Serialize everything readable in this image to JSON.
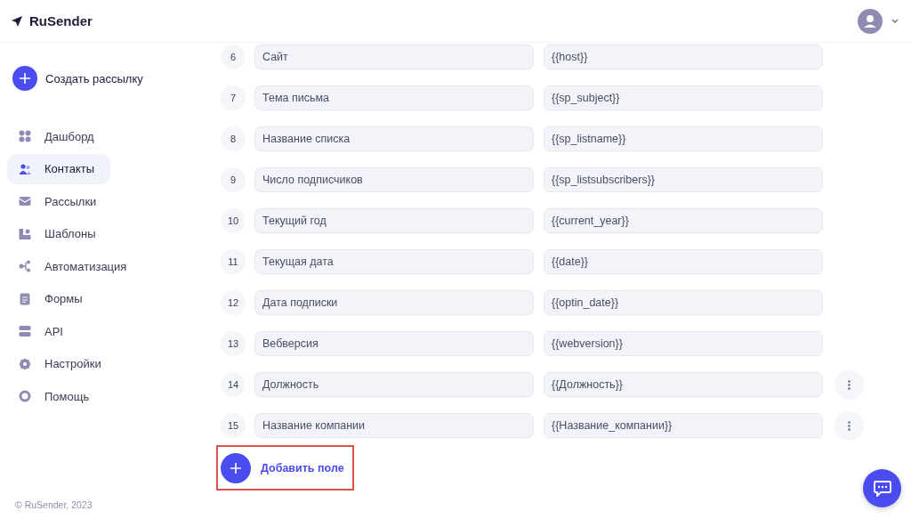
{
  "header": {
    "logo": "RuSender"
  },
  "sidebar": {
    "create_button": "Создать рассылку",
    "items": [
      {
        "label": "Дашборд",
        "selected": false
      },
      {
        "label": "Контакты",
        "selected": true
      },
      {
        "label": "Рассылки",
        "selected": false
      },
      {
        "label": "Шаблоны",
        "selected": false
      },
      {
        "label": "Автоматизация",
        "selected": false
      },
      {
        "label": "Формы",
        "selected": false
      },
      {
        "label": "API",
        "selected": false
      },
      {
        "label": "Настройки",
        "selected": false
      },
      {
        "label": "Помощь",
        "selected": false
      }
    ],
    "footer": "© RuSender, 2023"
  },
  "fields": [
    {
      "number": "6",
      "name": "Сайт",
      "variable": "{{host}}",
      "menu": false
    },
    {
      "number": "7",
      "name": "Тема письма",
      "variable": "{{sp_subject}}",
      "menu": false
    },
    {
      "number": "8",
      "name": "Название списка",
      "variable": "{{sp_listname}}",
      "menu": false
    },
    {
      "number": "9",
      "name": "Число подписчиков",
      "variable": "{{sp_listsubscribers}}",
      "menu": false
    },
    {
      "number": "10",
      "name": "Текущий год",
      "variable": "{{current_year}}",
      "menu": false
    },
    {
      "number": "11",
      "name": "Текущая дата",
      "variable": "{{date}}",
      "menu": false
    },
    {
      "number": "12",
      "name": "Дата подписки",
      "variable": "{{optin_date}}",
      "menu": false
    },
    {
      "number": "13",
      "name": "Вебверсия",
      "variable": "{{webversion}}",
      "menu": false
    },
    {
      "number": "14",
      "name": "Должность",
      "variable": "{{Должность}}",
      "menu": true
    },
    {
      "number": "15",
      "name": "Название компании",
      "variable": "{{Название_компании}}",
      "menu": true
    }
  ],
  "add_button": "Добавить поле"
}
